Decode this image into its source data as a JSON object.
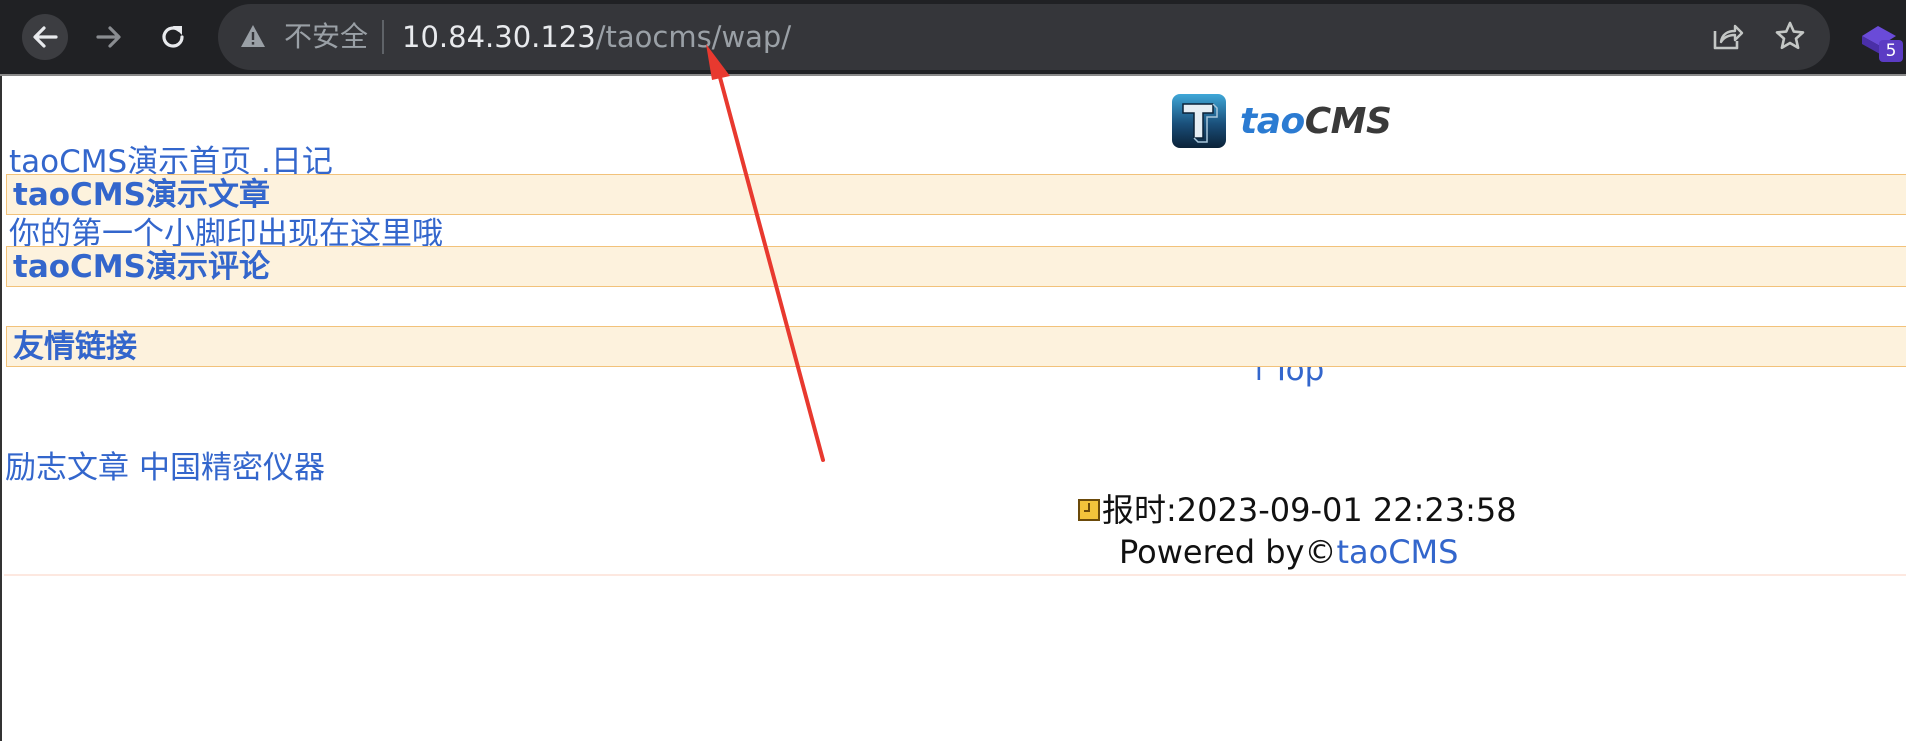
{
  "browser": {
    "security_label": "不安全",
    "url_host": "10.84.30.123",
    "url_path": "/taocms/wap/",
    "extension_badge": "5"
  },
  "page": {
    "logo": {
      "tao": "tao",
      "cms": "CMS"
    },
    "home_link": "taoCMS演示首页 .日记",
    "articles_heading": "taoCMS演示文章",
    "article_item": "你的第一个小脚印出现在这里哦",
    "comments_heading": "taoCMS演示评论",
    "top_link": "↑Top",
    "friend_links_heading": "友情链接",
    "friend_links": [
      "励志文章",
      "中国精密仪器"
    ],
    "time_label": "报时:2023-09-01 22:23:58",
    "powered_prefix": "Powered by©",
    "powered_link": "taoCMS"
  },
  "colors": {
    "link": "#3366cc",
    "band_bg": "#fdf2dd",
    "band_border": "#f2c27a",
    "annotation_arrow": "#e8392f"
  }
}
